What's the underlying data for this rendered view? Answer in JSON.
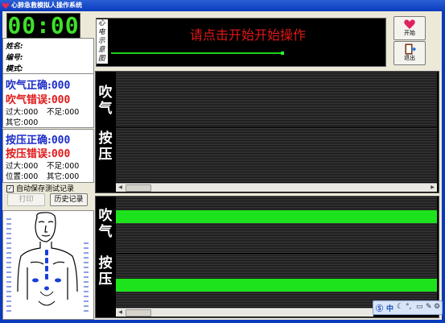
{
  "window": {
    "title": "心肺急救模拟人操作系统",
    "frame_color": "#0a3bbd"
  },
  "timer": {
    "value": "00:00",
    "color": "#3fe02a"
  },
  "patient_info": {
    "name_label": "姓名:",
    "id_label": "编号:",
    "mode_label": "模式:"
  },
  "breath_stats": {
    "correct_label": "吹气正确:",
    "correct_value": "000",
    "error_label": "吹气错误:",
    "error_value": "000",
    "too_much_label": "过大:",
    "too_much_value": "000",
    "insufficient_label": "不足:",
    "insufficient_value": "000",
    "other_label": "其它:",
    "other_value": "000"
  },
  "compress_stats": {
    "correct_label": "按压正确:",
    "correct_value": "000",
    "error_label": "按压错误:",
    "error_value": "000",
    "too_much_label": "过大:",
    "too_much_value": "000",
    "insufficient_label": "不足:",
    "insufficient_value": "000",
    "position_label": "位置:",
    "position_value": "000",
    "other_label": "其它:",
    "other_value": "000"
  },
  "options": {
    "autosave_label": "自动保存测试记录",
    "autosave_checked": true
  },
  "buttons": {
    "print_label": "打印",
    "print_enabled": false,
    "history_label": "历史记录",
    "start_label": "开始",
    "exit_label": "退出"
  },
  "ecg": {
    "side_label": "心电示意图",
    "prompt": "请点击开始开始操作",
    "prompt_color": "#e01818",
    "trace_color": "#18d218"
  },
  "charts": {
    "top_breath_label": "吹气",
    "top_compress_label": "按压",
    "bottom_breath_label": "吹气",
    "bottom_compress_label": "按压",
    "bar_color": "#1de31d"
  },
  "tray": {
    "lang_label": "中",
    "icons": [
      "ime-logo-icon",
      "moon-icon",
      "punctuation-icon",
      "keyboard-icon",
      "tools-icon",
      "settings-icon"
    ]
  }
}
